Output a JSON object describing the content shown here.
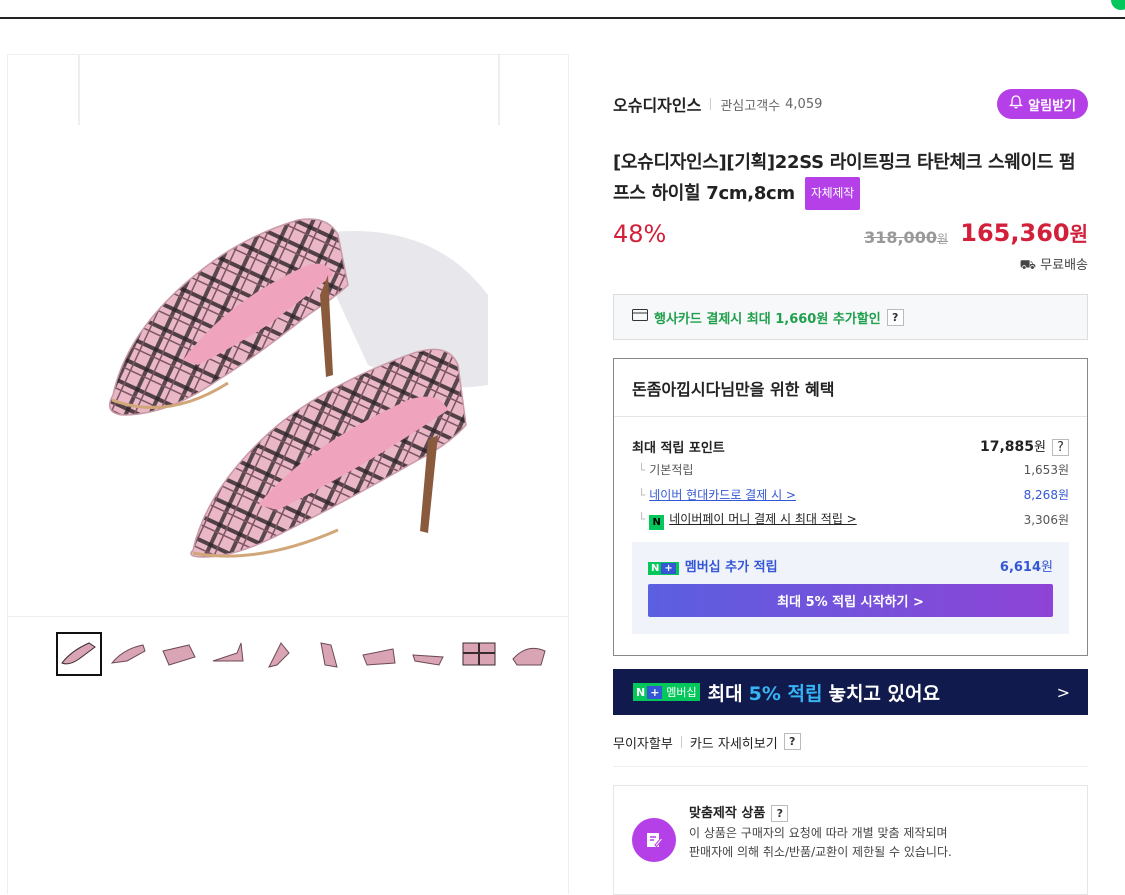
{
  "store": {
    "name": "오슈디자인스",
    "interest_label": "관심고객수",
    "interest_count": "4,059",
    "alarm_label": "알림받기"
  },
  "product": {
    "title": "[오슈디자인스][기획]22SS 라이트핑크 타탄체크 스웨이드 펌프스 하이힐 7cm,8cm",
    "badge": "자체제작",
    "discount": "48%",
    "original_price": "318,000",
    "original_unit": "원",
    "final_price": "165,360",
    "final_unit": "원",
    "shipping": "무료배송"
  },
  "card_offer": {
    "text": "행사카드 결제시 최대 1,660원 추가할인",
    "help": "?"
  },
  "benefits": {
    "heading": "돈좀아낍시다님만을 위한 혜택",
    "max_points_label": "최대 적립 포인트",
    "max_points_value": "17,885",
    "unit": "원",
    "rows": [
      {
        "label": "기본적립",
        "amount": "1,653원"
      },
      {
        "label": "네이버 현대카드로 결제 시 >",
        "amount": "8,268원"
      },
      {
        "label": "네이버페이 머니 결제 시 최대 적립 >",
        "amount": "3,306원"
      }
    ],
    "npay_icon": "N",
    "membership_badge": "N",
    "membership_plus": "+",
    "membership_label": "멤버십 추가 적립",
    "membership_amount": "6,614",
    "membership_button": "최대 5% 적립 시작하기 >"
  },
  "banner": {
    "badge_n": "N",
    "badge_plus": "+",
    "badge_text": "멤버십",
    "text_pre": "최대",
    "highlight": "5% 적립",
    "text_post": "놓치고 있어요",
    "chevron": ">"
  },
  "install": {
    "label1": "무이자할부",
    "label2": "카드 자세히보기",
    "help": "?"
  },
  "custom": {
    "title": "맞춤제작 상품",
    "help": "?",
    "desc1": "이 상품은 구매자의 요청에 따라 개별 맞춤 제작되며",
    "desc2": "판매자에 의해 취소/반품/교환이 제한될 수 있습니다."
  },
  "colors": {
    "accent": "#b540e8",
    "price_red": "#d3203a",
    "link_blue": "#3457d5",
    "naver_green": "#03c75a",
    "banner_navy": "#111a4d"
  },
  "thumbnails": [
    "shoe-thumb-1",
    "shoe-thumb-2",
    "shoe-thumb-3",
    "shoe-thumb-4",
    "shoe-thumb-5",
    "shoe-thumb-6",
    "shoe-thumb-7",
    "shoe-thumb-8",
    "shoe-thumb-9",
    "shoe-thumb-10"
  ]
}
